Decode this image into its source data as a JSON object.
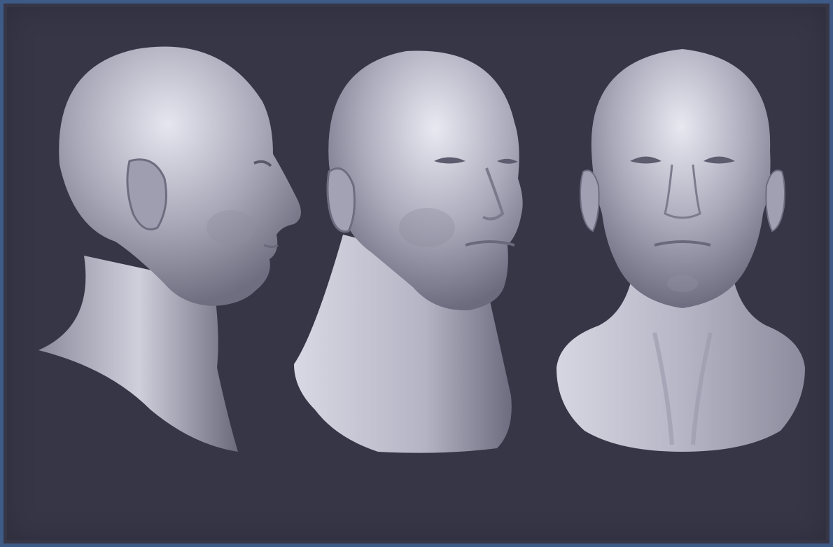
{
  "scene": {
    "background_color": "#373647",
    "border_color": "#3d5b86",
    "clay_color": "#b9b8c8",
    "views": [
      {
        "id": "profile",
        "icon": "bust-profile-view"
      },
      {
        "id": "three-quarter",
        "icon": "bust-three-quarter-view"
      },
      {
        "id": "front",
        "icon": "bust-front-view"
      }
    ]
  }
}
